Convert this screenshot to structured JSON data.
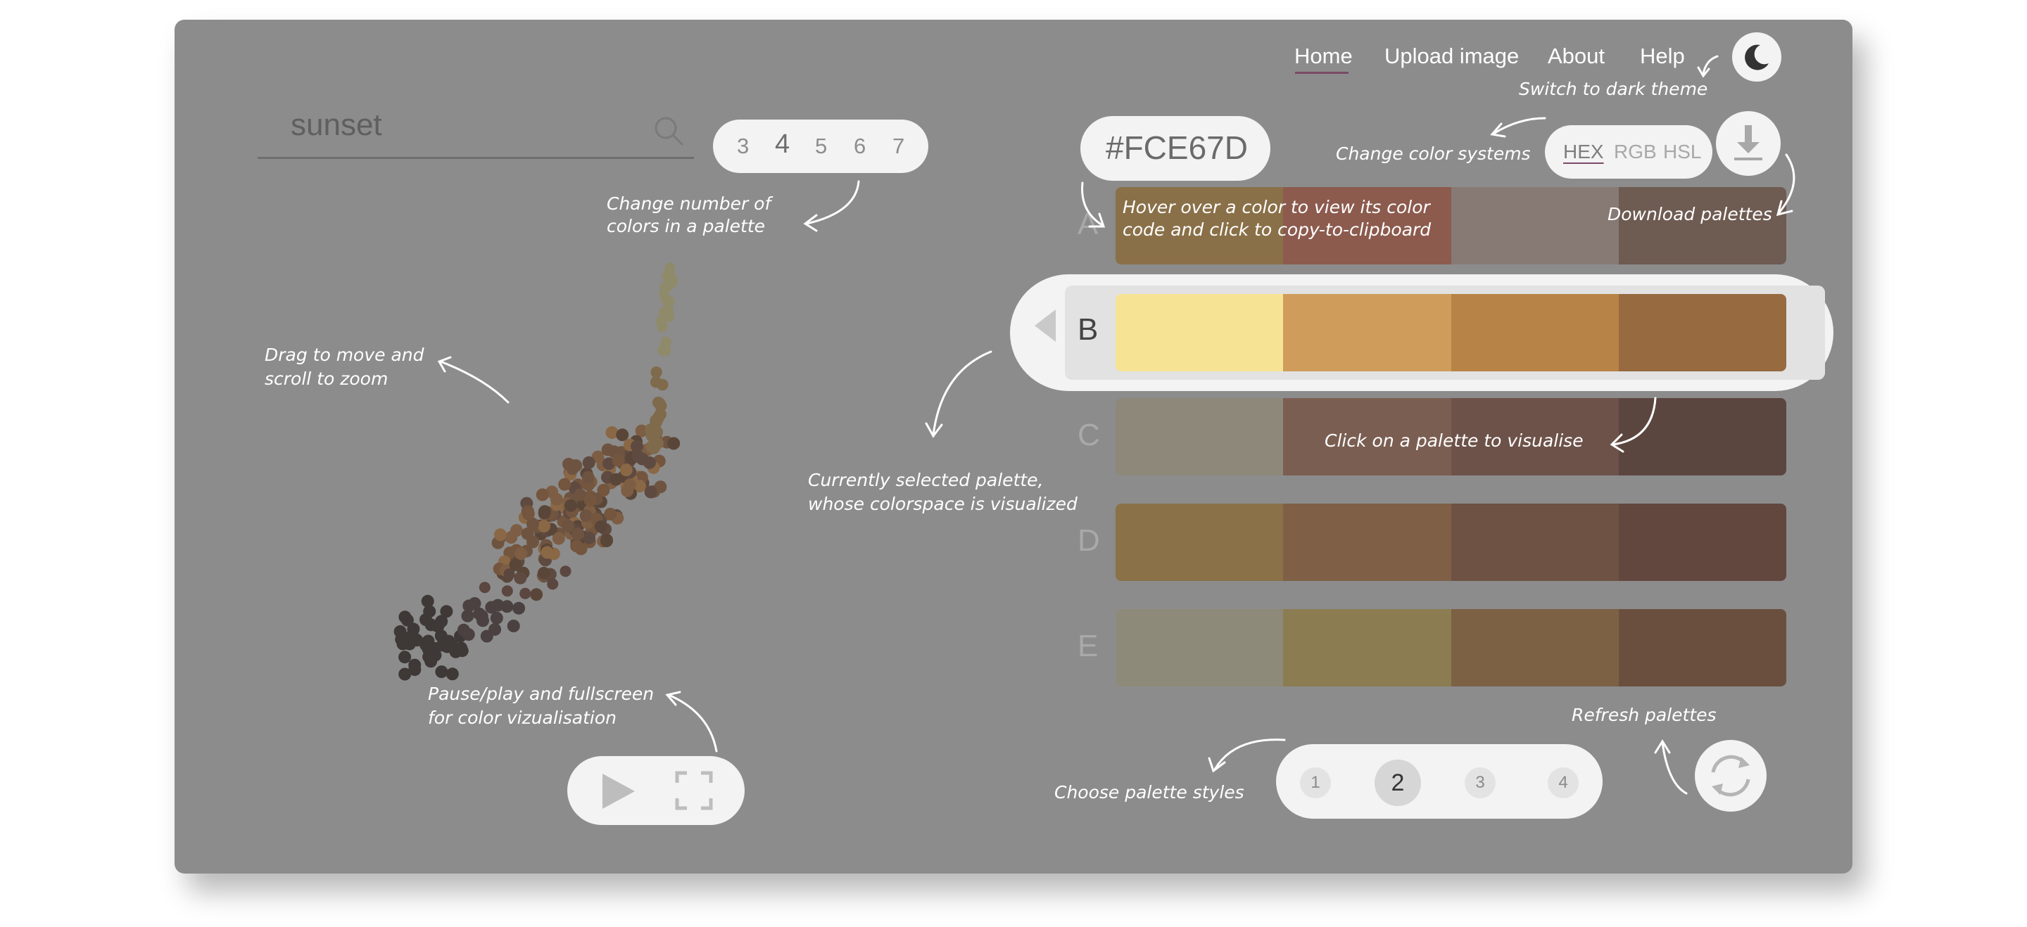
{
  "nav": {
    "items": [
      {
        "label": "Home",
        "active": true
      },
      {
        "label": "Upload image"
      },
      {
        "label": "About"
      },
      {
        "label": "Help"
      }
    ],
    "theme_icon": "moon-icon"
  },
  "search": {
    "value": "sunset",
    "icon": "search-icon"
  },
  "color_count": {
    "options": [
      "3",
      "4",
      "5",
      "6",
      "7"
    ],
    "selected": "4"
  },
  "hex_display": "#FCE67D",
  "color_systems": {
    "options": [
      "HEX",
      "RGB",
      "HSL"
    ],
    "selected": "HEX"
  },
  "download_icon": "download-icon",
  "palettes": [
    {
      "letter": "A",
      "colors": [
        "#8a7048",
        "#8c5b4e",
        "#877a75",
        "#6e5b52"
      ]
    },
    {
      "letter": "B",
      "colors": [
        "#f7e394",
        "#cf9c5b",
        "#b88347",
        "#976a3f"
      ],
      "selected": true
    },
    {
      "letter": "C",
      "colors": [
        "#8d887a",
        "#7b5e52",
        "#6d5249",
        "#5b463f"
      ]
    },
    {
      "letter": "D",
      "colors": [
        "#8a7148",
        "#7f6046",
        "#6e5244",
        "#62473f"
      ]
    },
    {
      "letter": "E",
      "colors": [
        "#8d8a7a",
        "#8b7c52",
        "#7d6145",
        "#6b4f3e"
      ]
    }
  ],
  "palette_styles": {
    "options": [
      "1",
      "2",
      "3",
      "4"
    ],
    "selected": "2"
  },
  "refresh_icon": "refresh-icon",
  "playback": {
    "play_icon": "play-icon",
    "fullscreen_icon": "fullscreen-icon"
  },
  "notes": {
    "switch_theme": "Switch to dark theme",
    "change_systems": "Change color systems",
    "download": "Download palettes",
    "hover_line1": "Hover over a color to view its color",
    "hover_line2": "code and click to copy-to-clipboard",
    "change_number_line1": "Change number of",
    "change_number_line2": "colors in a palette",
    "drag_line1": "Drag to move and",
    "drag_line2": "scroll to zoom",
    "selected_line1": "Currently selected palette,",
    "selected_line2": "whose colorspace is visualized",
    "click_palette": "Click on a palette to visualise",
    "pause_line1": "Pause/play and fullscreen",
    "pause_line2": "for color vizualisation",
    "choose_styles": "Choose palette styles",
    "refresh": "Refresh palettes"
  }
}
